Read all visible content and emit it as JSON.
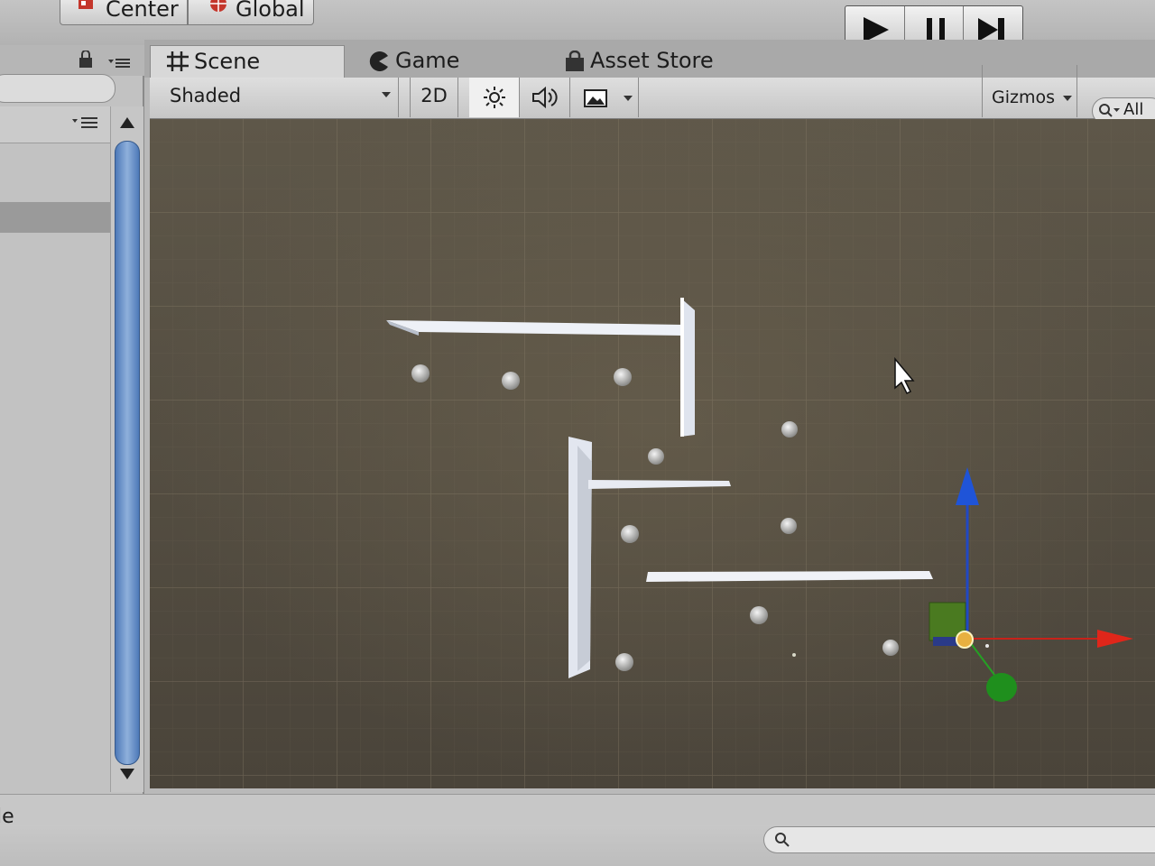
{
  "toolbar": {
    "pivot_label": "Center",
    "space_label": "Global",
    "play_icon": "play-icon",
    "pause_icon": "pause-icon",
    "step_icon": "step-icon"
  },
  "tabs": [
    {
      "label": "Scene",
      "icon": "grid-icon",
      "active": true
    },
    {
      "label": "Game",
      "icon": "pacman-icon",
      "active": false
    },
    {
      "label": "Asset Store",
      "icon": "bag-icon",
      "active": false
    }
  ],
  "scene_toolbar": {
    "draw_mode": "Shaded",
    "mode_2d": "2D",
    "gizmos_label": "Gizmos",
    "search_text": "All"
  },
  "status": {
    "left_text": "le"
  },
  "colors": {
    "viewport": "#524b3f",
    "gizmo_x": "#e0261a",
    "gizmo_y": "#1f54d8",
    "gizmo_z": "#25a024"
  }
}
